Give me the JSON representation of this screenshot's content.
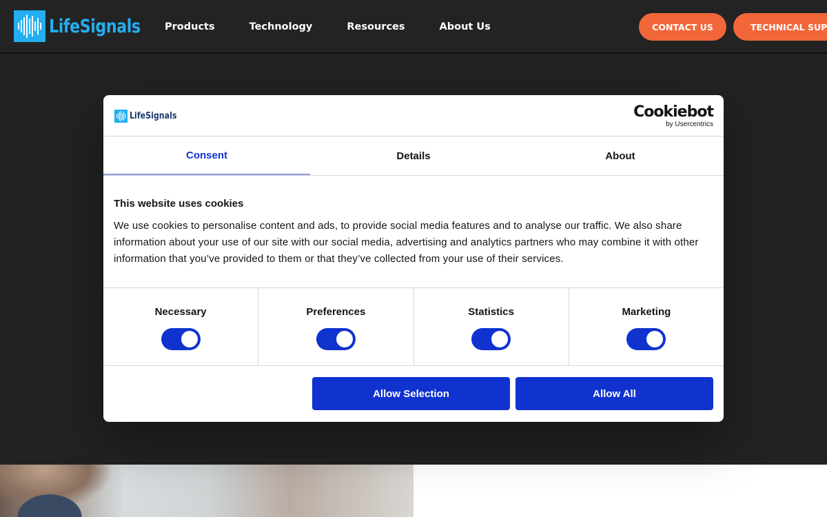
{
  "header": {
    "logo_text": "LifeSignals",
    "nav": [
      "Products",
      "Technology",
      "Resources",
      "About Us"
    ],
    "contact_label": "CONTACT US",
    "support_label": "TECHNICAL SUPPORT",
    "accent_color": "#f2673a",
    "brand_color": "#22aef0"
  },
  "dialog": {
    "logo_text": "LifeSignals",
    "cookiebot_title": "Cookiebot",
    "cookiebot_sub": "by Usercentrics",
    "tabs": [
      "Consent",
      "Details",
      "About"
    ],
    "active_tab": "Consent",
    "heading": "This website uses cookies",
    "body": "We use cookies to personalise content and ads, to provide social media features and to analyse our traffic. We also share information about your use of our site with our social media, advertising and analytics partners who may combine it with other information that you’ve provided to them or that they’ve collected from your use of their services.",
    "toggles": [
      {
        "label": "Necessary",
        "on": true
      },
      {
        "label": "Preferences",
        "on": true
      },
      {
        "label": "Statistics",
        "on": true
      },
      {
        "label": "Marketing",
        "on": true
      }
    ],
    "allow_selection_label": "Allow Selection",
    "allow_all_label": "Allow All",
    "primary_color": "#1032cf"
  }
}
